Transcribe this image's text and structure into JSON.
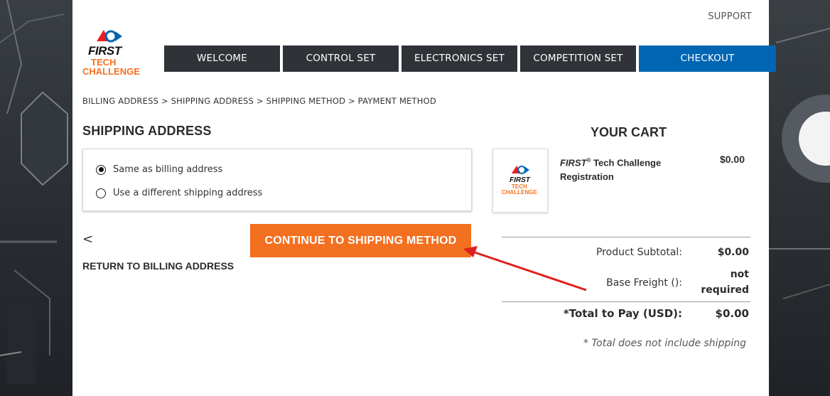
{
  "header": {
    "support_link": "SUPPORT",
    "logo": {
      "first": "FIRST",
      "tech": "TECH",
      "challenge": "CHALLENGE"
    }
  },
  "nav": {
    "tabs": [
      {
        "label": "WELCOME",
        "active": false
      },
      {
        "label": "CONTROL SET",
        "active": false
      },
      {
        "label": "ELECTRONICS SET",
        "active": false
      },
      {
        "label": "COMPETITION SET",
        "active": false
      },
      {
        "label": "CHECKOUT",
        "active": true
      }
    ]
  },
  "breadcrumb": "BILLING ADDRESS > SHIPPING ADDRESS > SHIPPING METHOD > PAYMENT METHOD",
  "shipping": {
    "title": "SHIPPING ADDRESS",
    "options": [
      {
        "label": "Same as billing address",
        "checked": true
      },
      {
        "label": "Use a different shipping address",
        "checked": false
      }
    ],
    "back_arrow": "<",
    "back_label": "RETURN TO BILLING ADDRESS",
    "continue_label": "CONTINUE TO SHIPPING METHOD"
  },
  "cart": {
    "title": "YOUR CART",
    "item": {
      "name_em": "FIRST",
      "name_sup": "®",
      "name_rest": " Tech Challenge Registration",
      "price": "$0.00",
      "thumb": {
        "first": "FIRST",
        "tech": "TECH",
        "challenge": "CHALLENGE"
      }
    },
    "subtotal_label": "Product Subtotal:",
    "subtotal_value": "$0.00",
    "freight_label": "Base Freight ():",
    "freight_value_1": "not",
    "freight_value_2": "required",
    "total_label": "*Total to Pay (USD):",
    "total_value": "$0.00",
    "note": "* Total does not include shipping"
  },
  "colors": {
    "accent_orange": "#f37021",
    "nav_dark": "#2f3338",
    "nav_active": "#0066b3",
    "annotation_arrow": "#e0201c"
  }
}
